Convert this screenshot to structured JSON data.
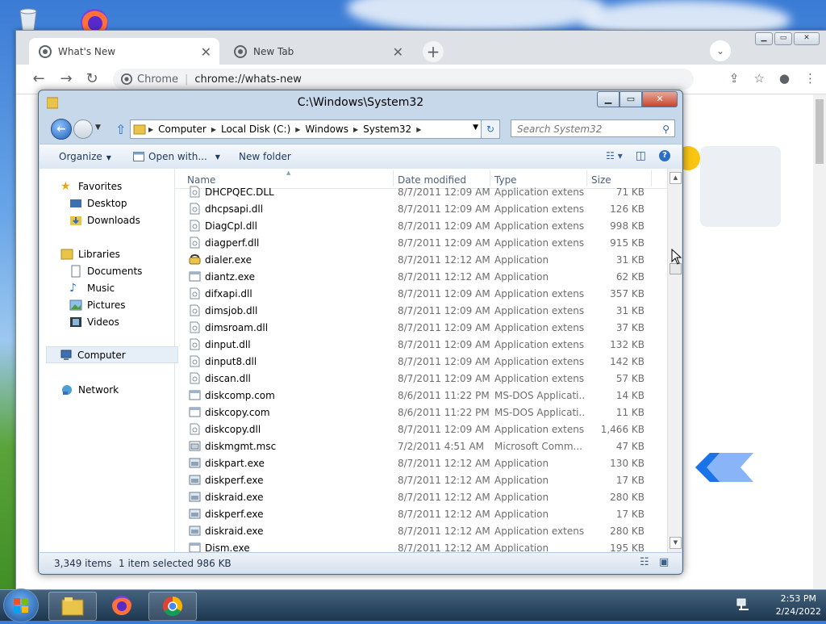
{
  "desktop": {
    "icons": [
      "recycle-bin-icon",
      "firefox-icon"
    ]
  },
  "chrome": {
    "tabs": [
      {
        "label": "What's New",
        "active": true
      },
      {
        "label": "New Tab",
        "active": false
      }
    ],
    "omnibox": {
      "site_label": "Chrome",
      "url": "chrome://whats-new"
    }
  },
  "explorer": {
    "title": "C:\\Windows\\System32",
    "breadcrumb": [
      "Computer",
      "Local Disk (C:)",
      "Windows",
      "System32"
    ],
    "search_placeholder": "Search System32",
    "commands": {
      "organize": "Organize",
      "open_with": "Open with...",
      "new_folder": "New folder"
    },
    "nav": {
      "favorites": "Favorites",
      "desktop": "Desktop",
      "downloads": "Downloads",
      "libraries": "Libraries",
      "documents": "Documents",
      "music": "Music",
      "pictures": "Pictures",
      "videos": "Videos",
      "computer": "Computer",
      "network": "Network"
    },
    "columns": {
      "name": "Name",
      "date": "Date modified",
      "type": "Type",
      "size": "Size"
    },
    "files": [
      {
        "name": "DHCPQEC.DLL",
        "date": "8/7/2011 12:09 AM",
        "type": "Application extens...",
        "size": "71 KB",
        "icon": "dll"
      },
      {
        "name": "dhcpsapi.dll",
        "date": "8/7/2011 12:09 AM",
        "type": "Application extens...",
        "size": "126 KB",
        "icon": "dll"
      },
      {
        "name": "DiagCpl.dll",
        "date": "8/7/2011 12:09 AM",
        "type": "Application extens...",
        "size": "998 KB",
        "icon": "dll"
      },
      {
        "name": "diagperf.dll",
        "date": "8/7/2011 12:09 AM",
        "type": "Application extens...",
        "size": "915 KB",
        "icon": "dll"
      },
      {
        "name": "dialer.exe",
        "date": "8/7/2011 12:12 AM",
        "type": "Application",
        "size": "31 KB",
        "icon": "phone"
      },
      {
        "name": "diantz.exe",
        "date": "8/7/2011 12:12 AM",
        "type": "Application",
        "size": "62 KB",
        "icon": "exe"
      },
      {
        "name": "difxapi.dll",
        "date": "8/7/2011 12:09 AM",
        "type": "Application extens...",
        "size": "357 KB",
        "icon": "dll"
      },
      {
        "name": "dimsjob.dll",
        "date": "8/7/2011 12:09 AM",
        "type": "Application extens...",
        "size": "31 KB",
        "icon": "dll"
      },
      {
        "name": "dimsroam.dll",
        "date": "8/7/2011 12:09 AM",
        "type": "Application extens...",
        "size": "37 KB",
        "icon": "dll"
      },
      {
        "name": "dinput.dll",
        "date": "8/7/2011 12:09 AM",
        "type": "Application extens...",
        "size": "132 KB",
        "icon": "dll"
      },
      {
        "name": "dinput8.dll",
        "date": "8/7/2011 12:09 AM",
        "type": "Application extens...",
        "size": "142 KB",
        "icon": "dll"
      },
      {
        "name": "discan.dll",
        "date": "8/7/2011 12:09 AM",
        "type": "Application extens...",
        "size": "57 KB",
        "icon": "dll"
      },
      {
        "name": "diskcomp.com",
        "date": "8/6/2011 11:22 PM",
        "type": "MS-DOS Applicati...",
        "size": "14 KB",
        "icon": "exe"
      },
      {
        "name": "diskcopy.com",
        "date": "8/6/2011 11:22 PM",
        "type": "MS-DOS Applicati...",
        "size": "11 KB",
        "icon": "exe"
      },
      {
        "name": "diskcopy.dll",
        "date": "8/7/2011 12:09 AM",
        "type": "Application extens...",
        "size": "1,466 KB",
        "icon": "dll"
      },
      {
        "name": "diskmgmt.msc",
        "date": "7/2/2011 4:51 AM",
        "type": "Microsoft Comm...",
        "size": "47 KB",
        "icon": "msc"
      },
      {
        "name": "diskpart.exe",
        "date": "8/7/2011 12:12 AM",
        "type": "Application",
        "size": "130 KB",
        "icon": "app"
      },
      {
        "name": "diskperf.exe",
        "date": "8/7/2011 12:12 AM",
        "type": "Application",
        "size": "17 KB",
        "icon": "app"
      },
      {
        "name": "diskraid.exe",
        "date": "8/7/2011 12:12 AM",
        "type": "Application",
        "size": "280 KB",
        "icon": "app"
      },
      {
        "name": "diskperf.exe",
        "date": "8/7/2011 12:12 AM",
        "type": "Application",
        "size": "17 KB",
        "icon": "app"
      },
      {
        "name": "diskraid.exe",
        "date": "8/7/2011 12:12 AM",
        "type": "Application extens...",
        "size": "280 KB",
        "icon": "app"
      },
      {
        "name": "Dism.exe",
        "date": "8/7/2011 12:12 AM",
        "type": "Application",
        "size": "195 KB",
        "icon": "exe"
      }
    ],
    "status": {
      "count": "3,349 items",
      "selection": "1 item selected 986 KB"
    }
  },
  "taskbar": {
    "apps": [
      "windows-explorer-icon",
      "firefox-icon",
      "chrome-icon"
    ],
    "time": "2:53 PM",
    "date": "2/24/2022"
  }
}
